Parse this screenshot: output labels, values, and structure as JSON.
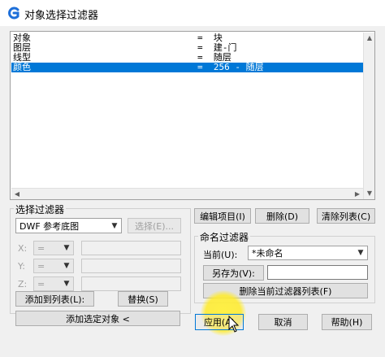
{
  "window": {
    "title": "对象选择过滤器"
  },
  "filter_list": {
    "rows": [
      {
        "key": "对象",
        "value": "=  块",
        "selected": false
      },
      {
        "key": "图层",
        "value": "=  建-门",
        "selected": false
      },
      {
        "key": "线型",
        "value": "=  随层",
        "selected": false
      },
      {
        "key": "颜色",
        "value": "=  256 - 随层",
        "selected": true
      }
    ]
  },
  "select_filter": {
    "group_label": "选择过滤器",
    "type_value": "DWF 参考底图",
    "select_button": "选择(E)...",
    "x_label": "X:",
    "y_label": "Y:",
    "z_label": "Z:",
    "op_value": "=",
    "add_to_list_button": "添加到列表(L):",
    "replace_button": "替换(S)",
    "add_selected_button": "添加选定对象 <"
  },
  "list_actions": {
    "edit_item_button": "编辑项目(I)",
    "delete_button": "删除(D)",
    "clear_list_button": "清除列表(C)"
  },
  "named_filters": {
    "group_label": "命名过滤器",
    "current_label": "当前(U):",
    "current_value": "*未命名",
    "save_as_button": "另存为(V):",
    "save_as_value": "",
    "delete_current_button": "删除当前过滤器列表(F)"
  },
  "footer": {
    "apply_button": "应用(A)",
    "cancel_button": "取消",
    "help_button": "帮助(H)"
  },
  "colors": {
    "selection": "#0078d7",
    "highlight": "#ffee33"
  }
}
